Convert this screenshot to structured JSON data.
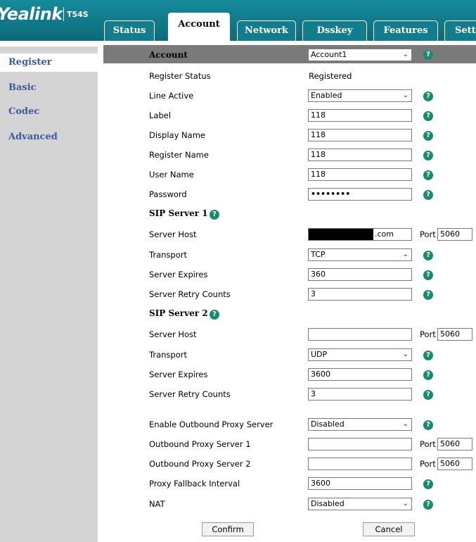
{
  "header": {
    "logo": "Yealink",
    "model": "T54S",
    "tabs": [
      "Status",
      "Account",
      "Network",
      "Dsskey",
      "Features",
      "Setti"
    ]
  },
  "sidebar": {
    "items": [
      "Register",
      "Basic",
      "Codec",
      "Advanced"
    ]
  },
  "account": {
    "label": "Account",
    "value": "Account1"
  },
  "register": {
    "status_label": "Register Status",
    "status_value": "Registered",
    "line_active_label": "Line Active",
    "line_active_value": "Enabled",
    "label_label": "Label",
    "label_value": "118",
    "display_name_label": "Display Name",
    "display_name_value": "118",
    "register_name_label": "Register Name",
    "register_name_value": "118",
    "user_name_label": "User Name",
    "user_name_value": "118",
    "password_label": "Password",
    "password_value": "••••••••"
  },
  "sip1": {
    "heading": "SIP Server 1",
    "host_label": "Server Host",
    "host_suffix": ".com",
    "port_label": "Port",
    "port_value": "5060",
    "transport_label": "Transport",
    "transport_value": "TCP",
    "expires_label": "Server Expires",
    "expires_value": "360",
    "retry_label": "Server Retry Counts",
    "retry_value": "3"
  },
  "sip2": {
    "heading": "SIP Server 2",
    "host_label": "Server Host",
    "host_value": "",
    "port_label": "Port",
    "port_value": "5060",
    "transport_label": "Transport",
    "transport_value": "UDP",
    "expires_label": "Server Expires",
    "expires_value": "3600",
    "retry_label": "Server Retry Counts",
    "retry_value": "3"
  },
  "proxy": {
    "enable_label": "Enable Outbound Proxy Server",
    "enable_value": "Disabled",
    "server1_label": "Outbound Proxy Server 1",
    "server1_port_label": "Port",
    "server1_port": "5060",
    "server2_label": "Outbound Proxy Server 2",
    "server2_port_label": "Port",
    "server2_port": "5060",
    "fallback_label": "Proxy Fallback Interval",
    "fallback_value": "3600",
    "nat_label": "NAT",
    "nat_value": "Disabled"
  },
  "buttons": {
    "confirm": "Confirm",
    "cancel": "Cancel"
  },
  "icons": {
    "help": "?",
    "chevron": "⌄"
  },
  "colors": {
    "header": "#137d8d",
    "sidebar": "#d4d4d4",
    "sidebar_link": "#3b5aa0",
    "help": "#1a8a6e",
    "account_bar": "#7a7a7a"
  }
}
